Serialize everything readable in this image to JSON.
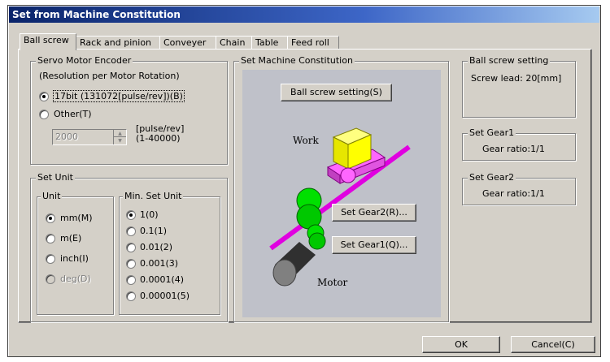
{
  "window": {
    "title": "Set from Machine Constitution"
  },
  "tabs": [
    "Ball screw",
    "Rack and pinion",
    "Conveyer",
    "Chain",
    "Table",
    "Feed roll"
  ],
  "encoder": {
    "group_title": "Servo Motor Encoder",
    "subtitle": "(Resolution per Motor Rotation)",
    "option_17bit": "17bit (131072[pulse/rev])(B)",
    "option_other": "Other(T)",
    "other_value": "2000",
    "unit_line1": "[pulse/rev]",
    "unit_line2": "(1-40000)",
    "selected": "17bit"
  },
  "set_unit": {
    "group_title": "Set Unit",
    "unit": {
      "title": "Unit",
      "options": [
        "mm(M)",
        "m(E)",
        "inch(I)",
        "deg(D)"
      ],
      "selected": "mm(M)"
    },
    "min_unit": {
      "title": "Min. Set Unit",
      "options": [
        "1(0)",
        "0.1(1)",
        "0.01(2)",
        "0.001(3)",
        "0.0001(4)",
        "0.00001(5)"
      ],
      "selected": "1(0)"
    }
  },
  "machine": {
    "group_title": "Set Machine Constitution",
    "ball_screw_button": "Ball screw setting(S)",
    "gear2_button": "Set Gear2(R)...",
    "gear1_button": "Set Gear1(Q)...",
    "work_label": "Work",
    "motor_label": "Motor"
  },
  "ball_screw_setting": {
    "group_title": "Ball screw setting",
    "screw_lead": "Screw lead:  20[mm]"
  },
  "gear1": {
    "group_title": "Set Gear1",
    "ratio": "Gear ratio:1/1"
  },
  "gear2": {
    "group_title": "Set Gear2",
    "ratio": "Gear ratio:1/1"
  },
  "footer": {
    "ok": "OK",
    "cancel": "Cancel(C)"
  },
  "colors": {
    "title_bar": "#0a246a",
    "face": "#d4d0c8",
    "diagram_bg": "#bfc1c9"
  }
}
